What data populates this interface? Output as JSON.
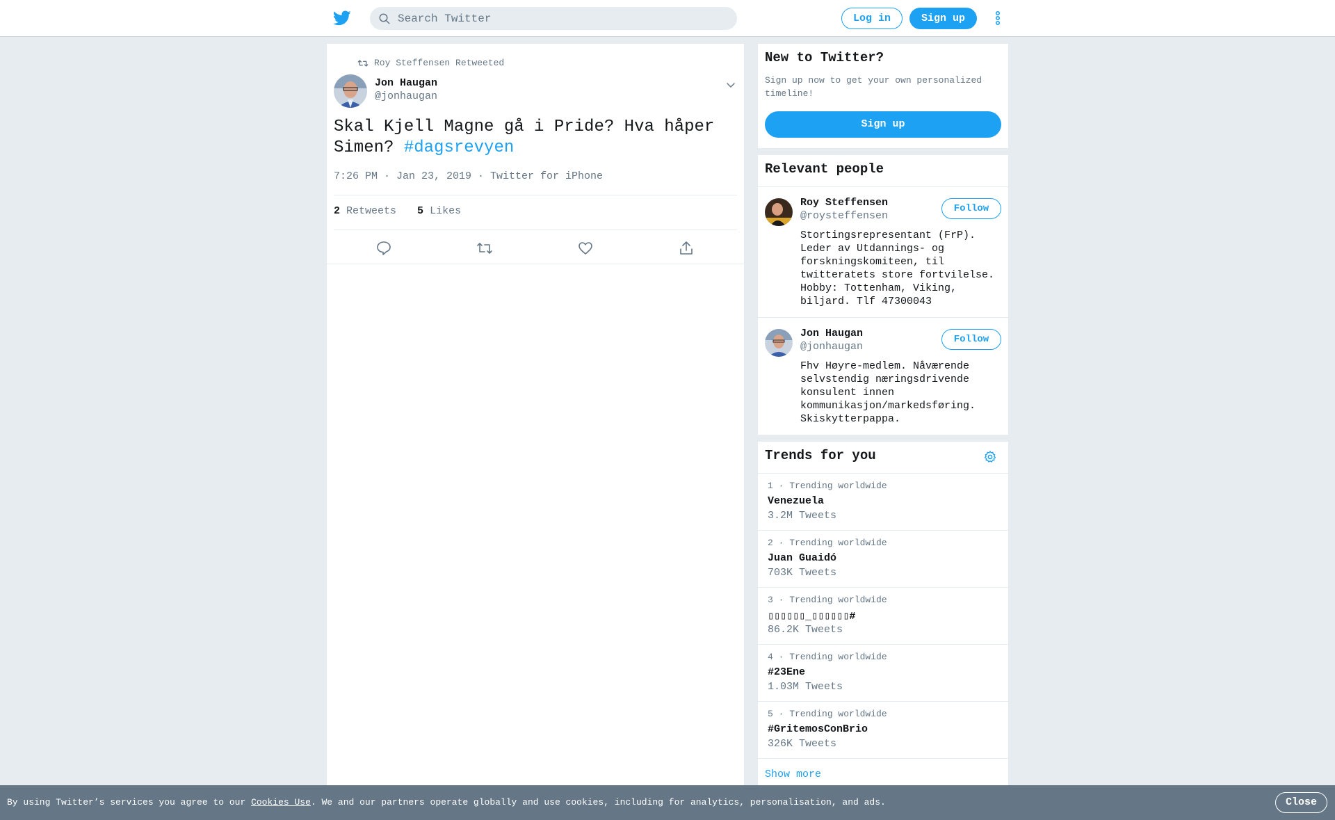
{
  "header": {
    "search_placeholder": "Search Twitter",
    "login_label": "Log in",
    "signup_label": "Sign up"
  },
  "tweet": {
    "retweeted_by": "Roy Steffensen Retweeted",
    "author_name": "Jon Haugan",
    "author_handle": "@jonhaugan",
    "text_part1": "Skal Kjell Magne gå i Pride? Hva håper Simen? ",
    "hashtag": "#dagsrevyen",
    "meta": "7:26 PM · Jan 23, 2019 · Twitter for iPhone",
    "retweets_count": "2",
    "retweets_label": "Retweets",
    "likes_count": "5",
    "likes_label": "Likes"
  },
  "new_to_twitter": {
    "title": "New to Twitter?",
    "subtitle": "Sign up now to get your own personalized timeline!",
    "signup_label": "Sign up"
  },
  "relevant_people": {
    "title": "Relevant people",
    "people": [
      {
        "name": "Roy Steffensen",
        "handle": "@roysteffensen",
        "bio": "Stortingsrepresentant (FrP). Leder av Utdannings- og forskningskomiteen, til twitteratets store fortvilelse. Hobby: Tottenham, Viking, biljard. Tlf 47300043",
        "follow_label": "Follow"
      },
      {
        "name": "Jon Haugan",
        "handle": "@jonhaugan",
        "bio": "Fhv Høyre-medlem. Nåværende selvstendig næringsdrivende konsulent innen kommunikasjon/markedsføring. Skiskytterpappa.",
        "follow_label": "Follow"
      }
    ]
  },
  "trends": {
    "title": "Trends for you",
    "items": [
      {
        "rank": "1 · Trending worldwide",
        "name": "Venezuela",
        "count": "3.2M Tweets"
      },
      {
        "rank": "2 · Trending worldwide",
        "name": "Juan Guaidó",
        "count": "703K Tweets"
      },
      {
        "rank": "3 · Trending worldwide",
        "name": "▯▯▯▯▯▯_▯▯▯▯▯▯#",
        "count": "86.2K Tweets"
      },
      {
        "rank": "4 · Trending worldwide",
        "name": "#23Ene",
        "count": "1.03M Tweets"
      },
      {
        "rank": "5 · Trending worldwide",
        "name": "#GritemosConBrio",
        "count": "326K Tweets"
      }
    ],
    "show_more": "Show more"
  },
  "cookie_bar": {
    "text_before": "By using Twitter’s services you agree to our ",
    "link": "Cookies Use",
    "text_after": ". We and our partners operate globally and use cookies, including for analytics, personalisation, and ads.",
    "close_label": "Close"
  },
  "colors": {
    "accent": "#1da1f2",
    "background": "#e6ecf0",
    "secondary_text": "#657786",
    "primary_text": "#14171a"
  }
}
